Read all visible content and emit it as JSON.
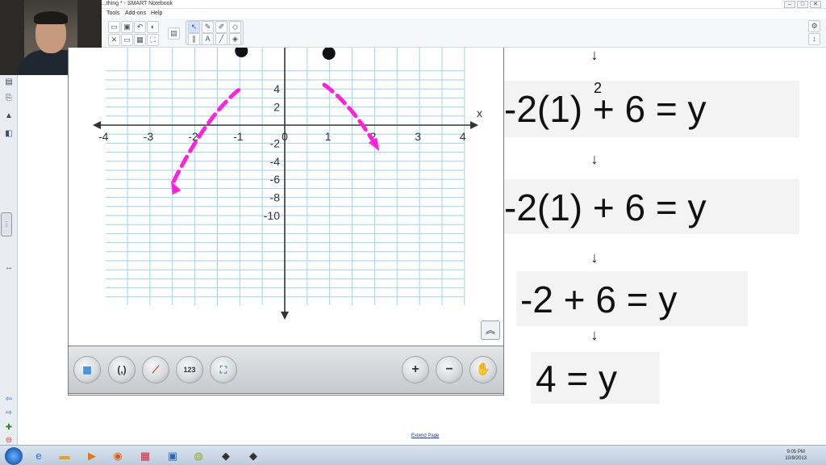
{
  "window": {
    "title": "...thing * - SMART Notebook",
    "min_label": "–",
    "max_label": "□",
    "close_label": "✕"
  },
  "menu": {
    "items": [
      "Tools",
      "Add-ons",
      "Help"
    ]
  },
  "graph": {
    "x_axis_label": "x",
    "x_ticks": [
      "-4",
      "-3",
      "-2",
      "-1",
      "0",
      "1",
      "2",
      "3",
      "4"
    ],
    "y_ticks": [
      "4",
      "2",
      "-2",
      "-4",
      "-6",
      "-8",
      "-10"
    ],
    "curve_color": "#ff22dd",
    "grid_color": "#9ed2ef"
  },
  "widget_toolbar": {
    "buttons": [
      {
        "name": "grid-button",
        "label": "▦"
      },
      {
        "name": "coordinates-button",
        "label": "(,)"
      },
      {
        "name": "line-button",
        "label": "⟋"
      },
      {
        "name": "number-line-button",
        "label": "123"
      },
      {
        "name": "fit-button",
        "label": "⛶"
      },
      {
        "name": "zoom-in-button",
        "label": "+"
      },
      {
        "name": "zoom-out-button",
        "label": "−"
      },
      {
        "name": "pan-button",
        "label": "✋"
      }
    ],
    "collapse_label": "︽"
  },
  "equations": {
    "line1": "-2(1)   +  6  =  y",
    "line1_exponent": "2",
    "line2": "-2(1)  +  6  =  y",
    "line3": "-2  +  6  =  y",
    "line4": "4  =  y",
    "arrow": "↓"
  },
  "bottom": {
    "extend_page": "Extend Page"
  },
  "taskbar": {
    "clock_time": "9:05 PM",
    "clock_date": "10/9/2013"
  }
}
